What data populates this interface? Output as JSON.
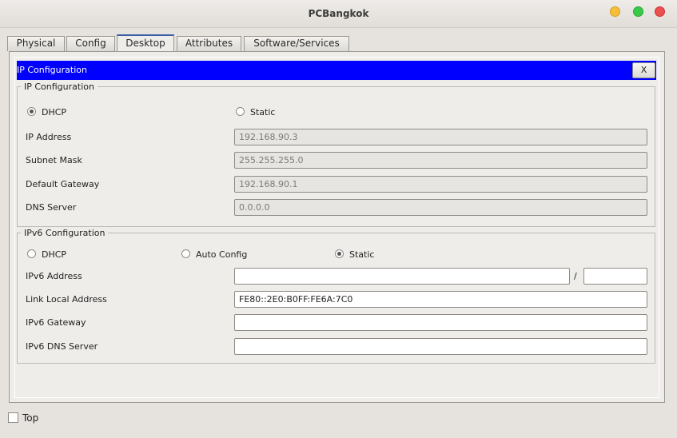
{
  "window": {
    "title": "PCBangkok"
  },
  "tabs": [
    "Physical",
    "Config",
    "Desktop",
    "Attributes",
    "Software/Services"
  ],
  "active_tab": "Desktop",
  "panel": {
    "title": "IP Configuration",
    "close_label": "X"
  },
  "ipv4": {
    "legend": "IP Configuration",
    "dhcp_label": "DHCP",
    "static_label": "Static",
    "mode": "DHCP",
    "ip_label": "IP Address",
    "ip_value": "192.168.90.3",
    "mask_label": "Subnet Mask",
    "mask_value": "255.255.255.0",
    "gw_label": "Default Gateway",
    "gw_value": "192.168.90.1",
    "dns_label": "DNS Server",
    "dns_value": "0.0.0.0"
  },
  "ipv6": {
    "legend": "IPv6 Configuration",
    "dhcp_label": "DHCP",
    "auto_label": "Auto Config",
    "static_label": "Static",
    "mode": "Static",
    "addr_label": "IPv6 Address",
    "addr_value": "",
    "slash": "/",
    "prefix_value": "",
    "link_label": "Link Local Address",
    "link_value": "FE80::2E0:B0FF:FE6A:7C0",
    "gw_label": "IPv6 Gateway",
    "gw_value": "",
    "dns_label": "IPv6 DNS Server",
    "dns_value": ""
  },
  "footer": {
    "top_label": "Top",
    "top_checked": false
  }
}
